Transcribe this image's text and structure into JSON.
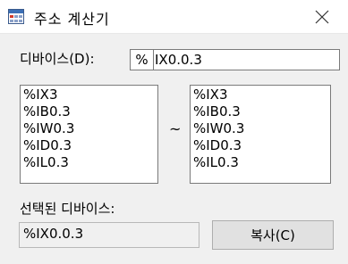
{
  "window": {
    "title": "주소 계산기",
    "close_icon": "close-icon",
    "app_icon": "calculator-grid-icon"
  },
  "device": {
    "label": "디바이스(D):",
    "prefix": "%",
    "value": "IX0.0.3"
  },
  "range": {
    "separator": "~",
    "start_items": [
      "%IX3",
      "%IB0.3",
      "%IW0.3",
      "%ID0.3",
      "%IL0.3"
    ],
    "end_items": [
      "%IX3",
      "%IB0.3",
      "%IW0.3",
      "%ID0.3",
      "%IL0.3"
    ]
  },
  "selected": {
    "label": "선택된 디바이스:",
    "value": "%IX0.0.3"
  },
  "actions": {
    "copy_label": "복사(C)"
  }
}
